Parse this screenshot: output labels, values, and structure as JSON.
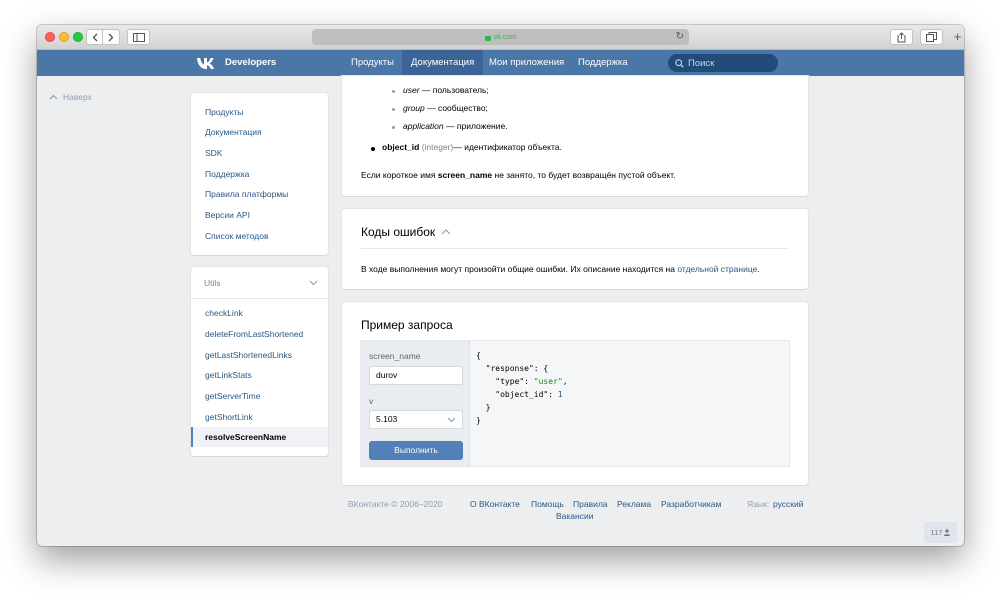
{
  "browser": {
    "address_text": "vk.com",
    "plus": "+"
  },
  "header": {
    "brand": "Developers",
    "nav": [
      {
        "label": "Продукты",
        "active": false
      },
      {
        "label": "Документация",
        "active": true
      },
      {
        "label": "Мои приложения",
        "active": false
      },
      {
        "label": "Поддержка",
        "active": false
      }
    ],
    "search_placeholder": "Поиск"
  },
  "up_button": "Наверх",
  "sidebar": {
    "main_menu": [
      "Продукты",
      "Документация",
      "SDK",
      "Поддержка",
      "Правила платформы",
      "Версии API",
      "Список методов"
    ],
    "section_title": "Utils",
    "methods": [
      "checkLink",
      "deleteFromLastShortened",
      "getLastShortenedLinks",
      "getLinkStats",
      "getServerTime",
      "getShortLink",
      "resolveScreenName"
    ],
    "active_method": "resolveScreenName"
  },
  "description": {
    "types": [
      {
        "name": "user",
        "text": " — пользователь;"
      },
      {
        "name": "group",
        "text": " — сообщество;"
      },
      {
        "name": "application",
        "text": " — приложение."
      }
    ],
    "object_id": {
      "name": "object_id",
      "type": "(integer)",
      "text": "— идентификатор объекта."
    },
    "note_before": "Если короткое имя ",
    "note_bold": "screen_name",
    "note_after": " не занято, то будет возвращён пустой объект."
  },
  "errors": {
    "title": "Коды ошибок",
    "text": "В ходе выполнения могут произойти общие ошибки. Их описание находится на ",
    "link": "отдельной странице",
    "text_end": "."
  },
  "request": {
    "title": "Пример запроса",
    "param1_label": "screen_name",
    "param1_value": "durov",
    "param2_label": "v",
    "param2_value": "5.103",
    "run_label": "Выполнить",
    "response": {
      "l1": "{",
      "l2_key": "  \"response\": {",
      "l3_key": "    \"type\": ",
      "l3_val": "\"user\"",
      "l3_end": ",",
      "l4_key": "    \"object_id\": ",
      "l4_val": "1",
      "l5": "  }",
      "l6": "}"
    }
  },
  "footer": {
    "copyright": "ВКонтакте © 2006–2020",
    "links": [
      "О ВКонтакте",
      "Помощь",
      "Правила",
      "Реклама",
      "Разработчикам"
    ],
    "vacancies": "Вакансии",
    "lang_label": "Язык:",
    "lang_value": "русский",
    "counter": "117"
  }
}
